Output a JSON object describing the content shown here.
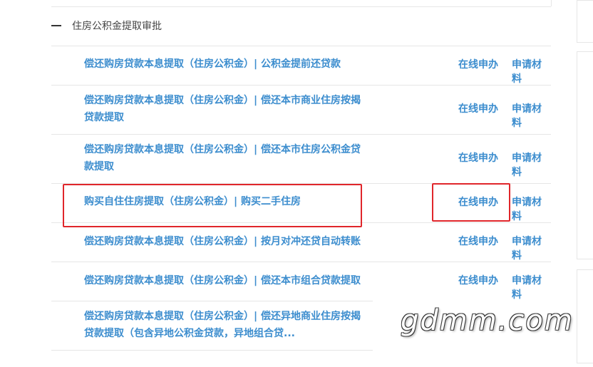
{
  "section": {
    "title": "住房公积金提取审批"
  },
  "rows": [
    {
      "name": "偿还购房贷款本息提取（住房公积金）| 公积金提前还贷款",
      "apply": "在线申办",
      "material": "申请材料"
    },
    {
      "name": "偿还购房贷款本息提取（住房公积金）| 偿还本市商业住房按揭贷款提取",
      "apply": "在线申办",
      "material": "申请材料"
    },
    {
      "name": "偿还购房贷款本息提取（住房公积金）| 偿还本市住房公积金贷款提取",
      "apply": "在线申办",
      "material": "申请材料"
    },
    {
      "name": "购买自住住房提取（住房公积金）| 购买二手住房",
      "apply": "在线申办",
      "material": "申请材料"
    },
    {
      "name": "偿还购房贷款本息提取（住房公积金）| 按月对冲还贷自动转账",
      "apply": "在线申办",
      "material": "申请材料"
    },
    {
      "name": "偿还购房贷款本息提取（住房公积金）| 偿还本市组合贷款提取",
      "apply": "在线申办",
      "material": "申请材料"
    },
    {
      "name": "偿还购房贷款本息提取（住房公积金）| 偿还异地商业住房按揭贷款提取（包含异地公积金贷款，异地组合贷...",
      "apply": "在线申办",
      "material": "申请材料"
    }
  ],
  "watermark": "gdmm.com",
  "colors": {
    "link": "#3c8dce",
    "highlight": "#e0262b",
    "divider": "#e6e6e6"
  }
}
